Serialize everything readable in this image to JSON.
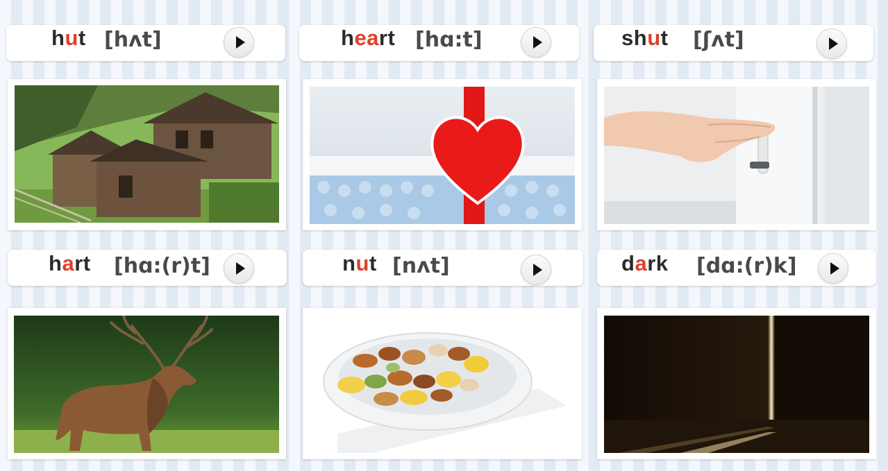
{
  "cards": [
    {
      "word": {
        "pre": "h",
        "hl": "u",
        "post": "t"
      },
      "ipa": "[hʌt]",
      "play_icon": "play-icon",
      "image": "wooden-hut-in-meadow"
    },
    {
      "word": {
        "pre": "h",
        "hl": "ea",
        "post": "rt"
      },
      "ipa": "[hɑ:t]",
      "play_icon": "play-icon",
      "image": "red-heart-clothespin"
    },
    {
      "word": {
        "pre": "sh",
        "hl": "u",
        "post": "t"
      },
      "ipa": "[ʃʌt]",
      "play_icon": "play-icon",
      "image": "hand-closing-door"
    },
    {
      "word": {
        "pre": "h",
        "hl": "a",
        "post": "rt"
      },
      "ipa": "[hɑ:(r)t]",
      "play_icon": "play-icon",
      "image": "red-deer-stag"
    },
    {
      "word": {
        "pre": "n",
        "hl": "u",
        "post": "t"
      },
      "ipa": "[nʌt]",
      "play_icon": "play-icon",
      "image": "bowl-of-nuts"
    },
    {
      "word": {
        "pre": "d",
        "hl": "a",
        "post": "rk"
      },
      "ipa": "[dɑ:(r)k]",
      "play_icon": "play-icon",
      "image": "dark-room-light-through-door"
    }
  ],
  "colors": {
    "highlight": "#e0402b",
    "word": "#2b2b2b",
    "ipa": "#4a4a4a"
  }
}
